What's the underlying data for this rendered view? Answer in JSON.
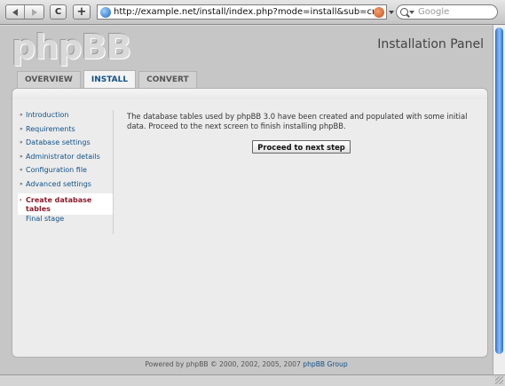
{
  "browser": {
    "url": "http://example.net/install/index.php?mode=install&sub=create_t",
    "search_placeholder": "Google",
    "add_label": "+",
    "reload_label": "C"
  },
  "header": {
    "logo_text": "phpBB",
    "panel_title": "Installation Panel"
  },
  "tabs": [
    {
      "label": "Overview",
      "active": false
    },
    {
      "label": "Install",
      "active": true
    },
    {
      "label": "Convert",
      "active": false
    }
  ],
  "menu": {
    "items": [
      {
        "label": "Introduction",
        "state": "done"
      },
      {
        "label": "Requirements",
        "state": "done"
      },
      {
        "label": "Database settings",
        "state": "done"
      },
      {
        "label": "Administrator details",
        "state": "done"
      },
      {
        "label": "Configuration file",
        "state": "done"
      },
      {
        "label": "Advanced settings",
        "state": "done"
      },
      {
        "label": "Create database tables",
        "state": "current"
      },
      {
        "label": "Final stage",
        "state": "pending"
      }
    ]
  },
  "content": {
    "message": "The database tables used by phpBB 3.0 have been created and populated with some initial data. Proceed to the next screen to finish installing phpBB.",
    "proceed_button": "Proceed to next step"
  },
  "footer": {
    "prefix": "Powered by phpBB © 2000, 2002, 2005, 2007",
    "link": "phpBB Group"
  },
  "colors": {
    "link": "#105289",
    "current_item": "#8b1a2b",
    "panel_bg": "#ececec"
  }
}
